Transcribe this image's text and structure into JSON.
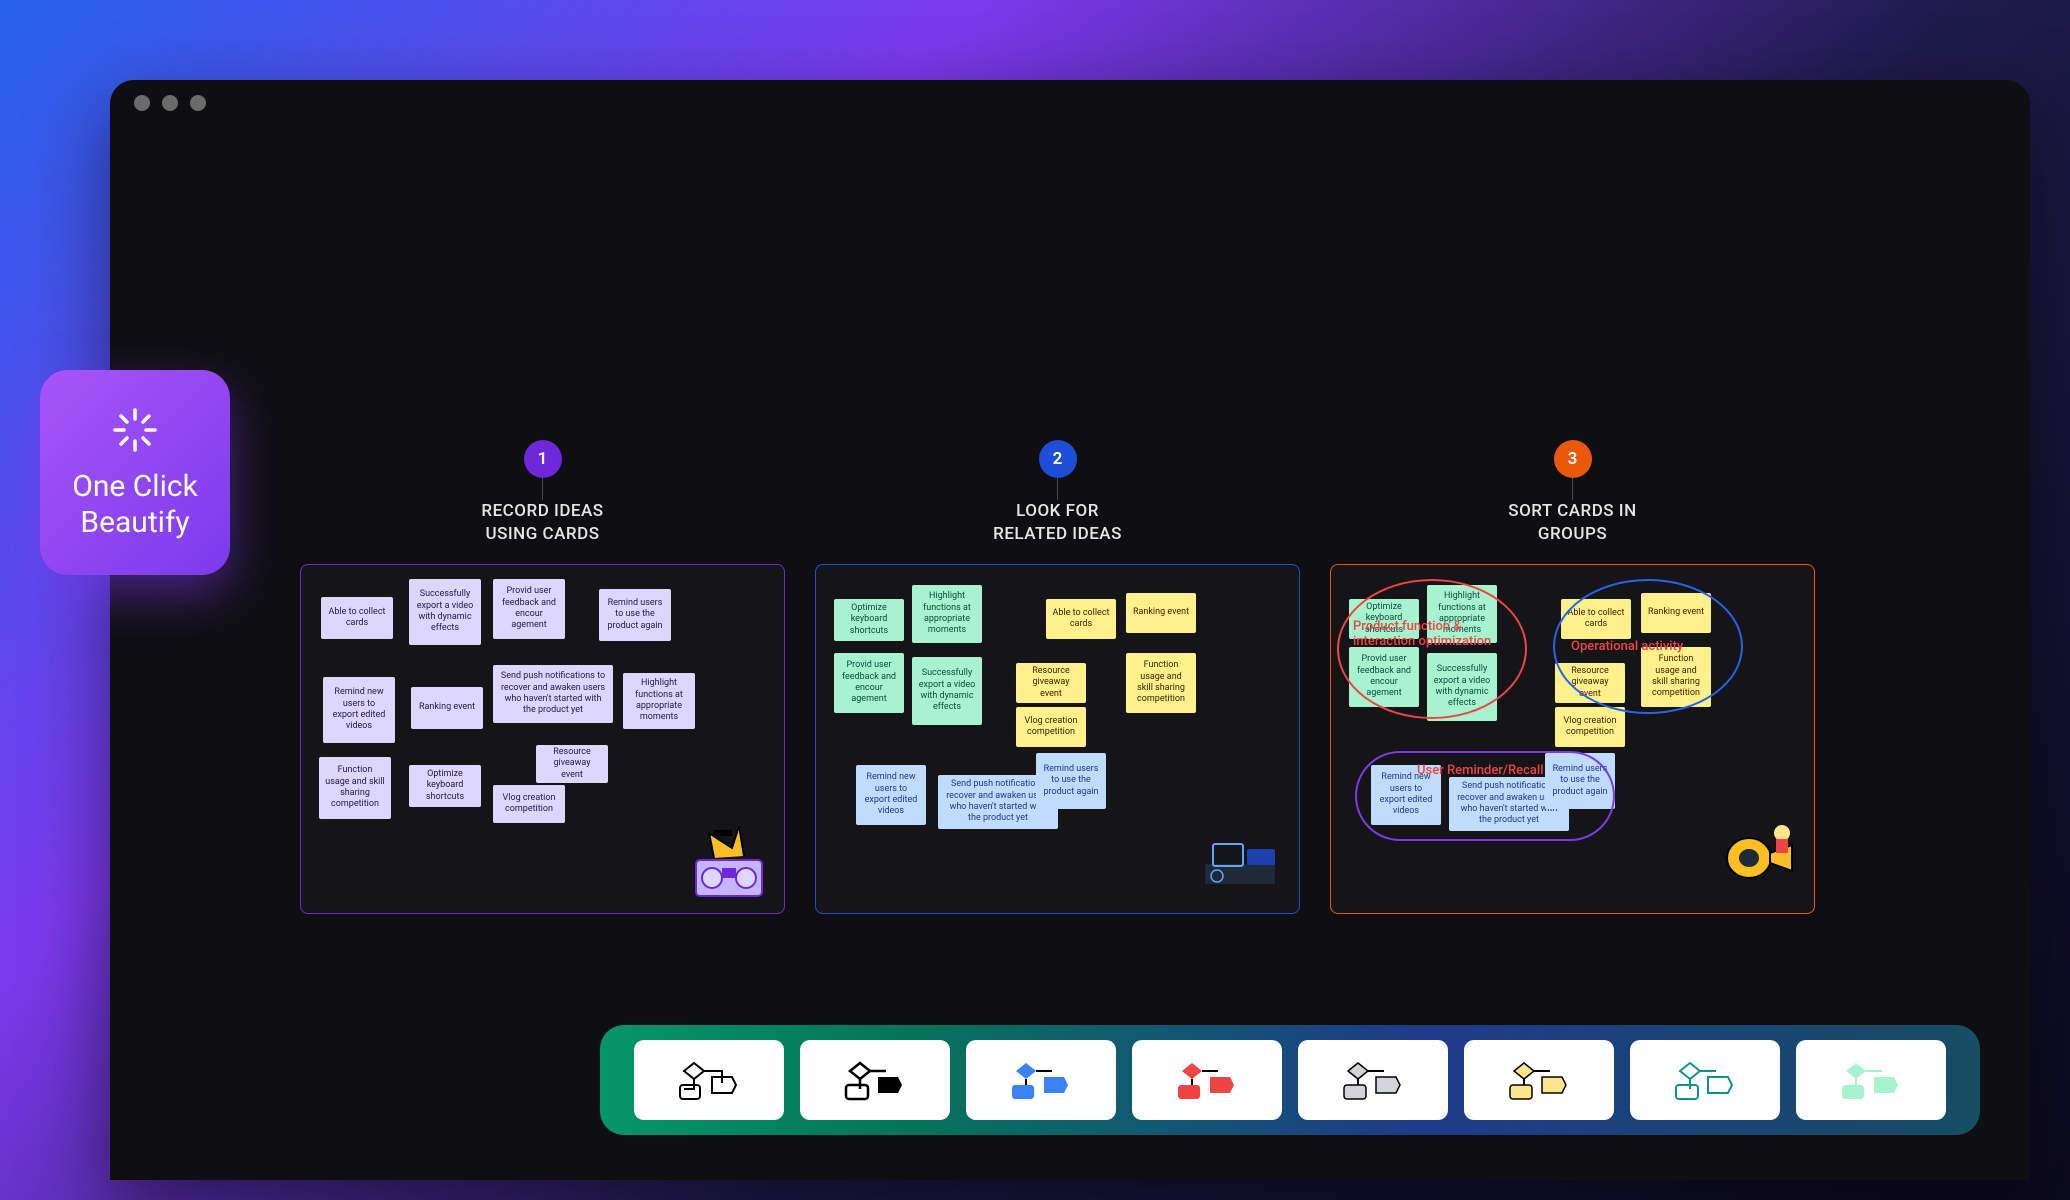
{
  "beautify": {
    "line1": "One Click",
    "line2": "Beautify"
  },
  "sections": [
    {
      "num": "1",
      "title_l1": "RECORD IDEAS",
      "title_l2": "USING CARDS"
    },
    {
      "num": "2",
      "title_l1": "LOOK FOR",
      "title_l2": "RELATED IDEAS"
    },
    {
      "num": "3",
      "title_l1": "SORT CARDS IN",
      "title_l2": "GROUPS"
    }
  ],
  "cards1": {
    "c0": "Able to collect cards",
    "c1": "Successfully export a video with dynamic effects",
    "c2": "Provid user feedback and encour agement",
    "c3": "Remind users to use the product again",
    "c4": "Remind new users to export edited videos",
    "c5": "Ranking event",
    "c6": "Send push notifications to recover and awaken users who haven't started with the product yet",
    "c7": "Highlight functions at appropriate moments",
    "c8": "Function usage and skill sharing competition",
    "c9": "Optimize keyboard shortcuts",
    "c10": "Vlog creation competition",
    "c11": "Resource giveaway event"
  },
  "cards2": {
    "c0": "Optimize keyboard shortcuts",
    "c1": "Highlight functions at appropriate moments",
    "c2": "Able to collect cards",
    "c3": "Ranking event",
    "c4": "Provid user feedback and encour agement",
    "c5": "Successfully export a video with dynamic effects",
    "c6": "Resource giveaway event",
    "c7": "Function usage and skill sharing competition",
    "c8": "Vlog creation competition",
    "c9": "Remind new users to export edited videos",
    "c10": "Send push notifications recover and awaken use... who haven't started with the product yet",
    "c11": "Remind users to use the product again"
  },
  "cards3": {
    "c0": "Optimize keyboard shortcuts",
    "c1": "Highlight functions at appropriate moments",
    "c2": "Able to collect cards",
    "c3": "Ranking event",
    "c4": "Provid user feedback and encour agement",
    "c5": "Successfully export a video with dynamic effects",
    "c6": "Resource giveaway event",
    "c7": "Function usage and skill sharing competition",
    "c8": "Vlog creation competition",
    "c9": "Remind new users to export edited videos",
    "c10": "Send push notifications recover and awaken use... who haven't started with the product yet",
    "c11": "Remind users to use the product again"
  },
  "annotations": {
    "a1": "Product function & interaction optimization",
    "a2": "Operational activity",
    "a3": "User Reminder/Recall"
  },
  "toolbar_styles": [
    "black",
    "black",
    "blue",
    "red",
    "gray",
    "yellow",
    "teal",
    "mint"
  ]
}
